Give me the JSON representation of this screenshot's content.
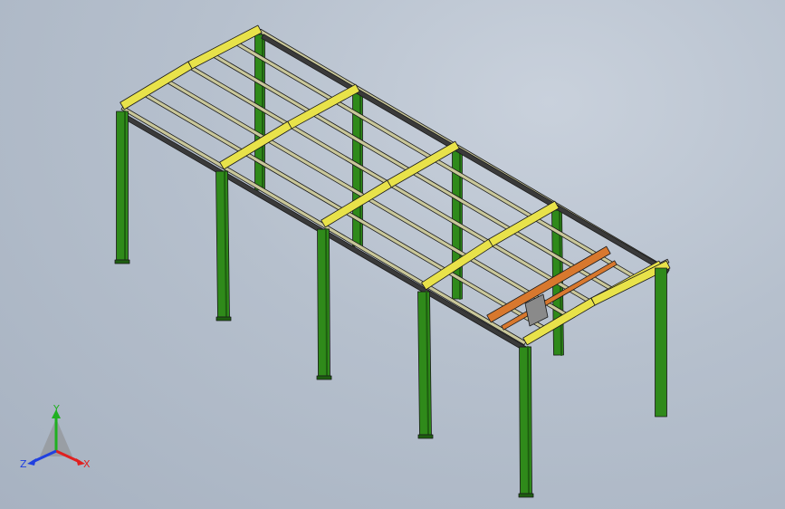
{
  "colors": {
    "background_top": "#c9d1dc",
    "background_bottom": "#a7b2c1",
    "column": "#2f8a1a",
    "column_dark": "#1e5e10",
    "rafter": "#e8e24a",
    "purlin": "#c9c79a",
    "outline": "#1a1a1a",
    "crane": "#d8782e",
    "axis_x": "#e02020",
    "axis_y": "#20b020",
    "axis_z": "#2040e0"
  },
  "triad": {
    "x_label": "X",
    "y_label": "Y",
    "z_label": "Z"
  }
}
